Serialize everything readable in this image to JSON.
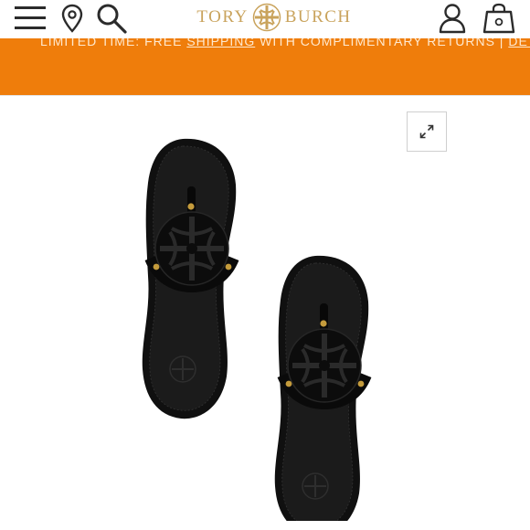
{
  "header": {
    "brand_left": "TORY",
    "brand_right": "BURCH",
    "brand_color": "#c9a35c",
    "icons": [
      "menu-icon",
      "location-pin-icon",
      "search-icon",
      "account-icon",
      "shopping-bag-icon"
    ]
  },
  "promo": {
    "background": "#ef7d0b",
    "text_before": "LIMITED TIME: FREE ",
    "link1": "SHIPPING",
    "text_middle": " WITH COMPLIMENTARY RETURNS | ",
    "link2": "DETAILS"
  },
  "product": {
    "image": "black-leather-thong-sandals",
    "expand_icon": "expand-icon"
  }
}
